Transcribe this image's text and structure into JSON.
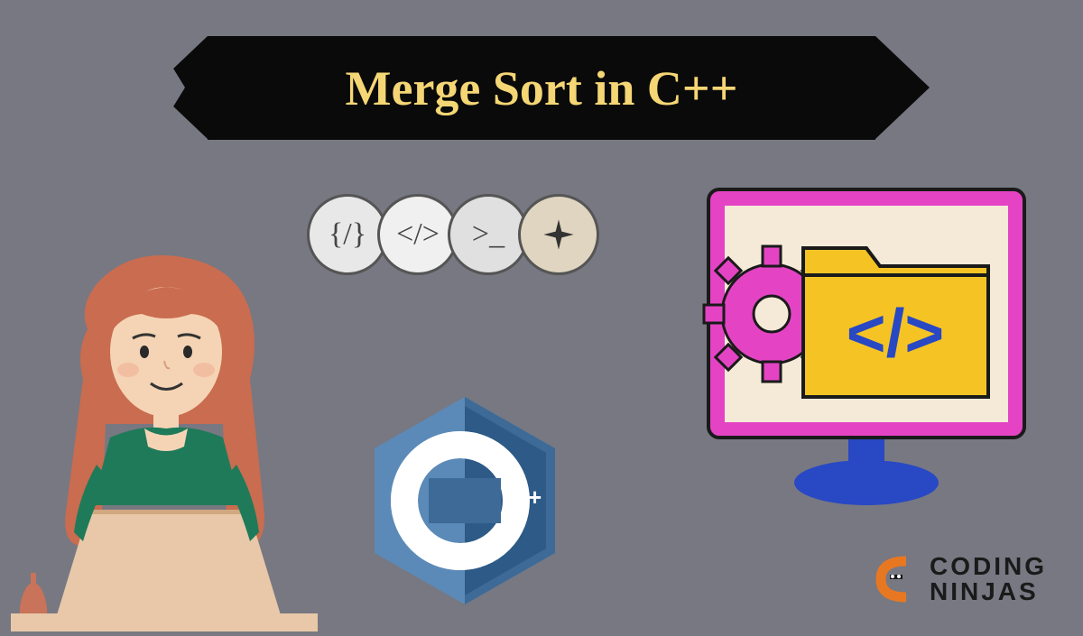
{
  "banner": {
    "title": "Merge Sort in C++"
  },
  "badges": [
    {
      "symbol": "{/}",
      "name": "code-braces"
    },
    {
      "symbol": "</>",
      "name": "code-tag"
    },
    {
      "symbol": ">_",
      "name": "terminal"
    },
    {
      "symbol": "✦",
      "name": "sparkle"
    }
  ],
  "cpp_logo": {
    "letter": "C",
    "suffix": "++"
  },
  "brand": {
    "line1": "CODING",
    "line2": "NINJAS"
  },
  "monitor": {
    "code_symbol": "</>"
  }
}
